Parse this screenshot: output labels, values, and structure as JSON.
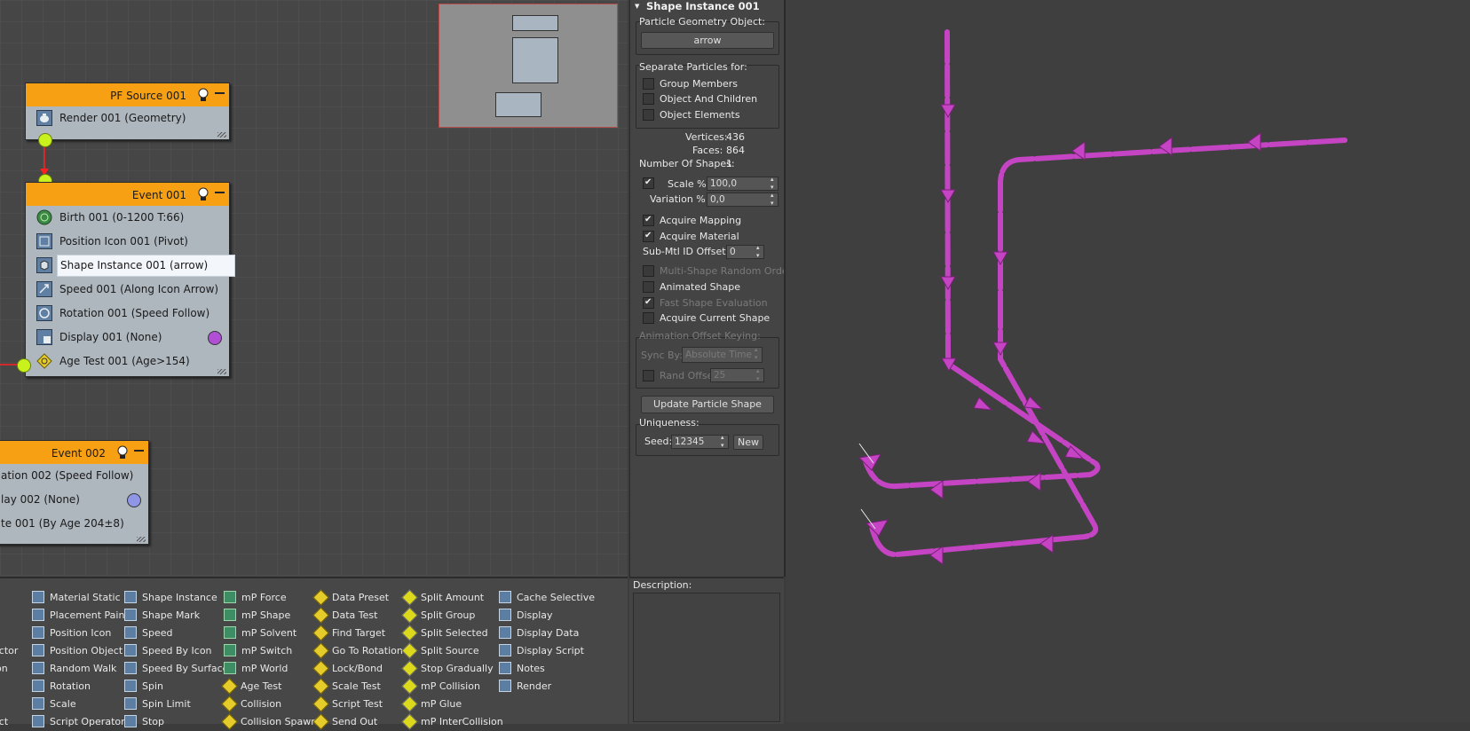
{
  "graph": {
    "nodes": {
      "pf_source": {
        "title": "PF Source 001",
        "rows": [
          "Render 001 (Geometry)"
        ]
      },
      "event001": {
        "title": "Event 001",
        "rows": [
          "Birth 001 (0-1200 T:66)",
          "Position Icon 001 (Pivot)",
          "Shape Instance 001 (arrow)",
          "Speed 001 (Along Icon Arrow)",
          "Rotation 001 (Speed Follow)",
          "Display 001 (None)",
          "Age Test 001 (Age>154)"
        ]
      },
      "event002": {
        "title": "Event 002",
        "rows": [
          "ation 002 (Speed Follow)",
          "lay 002 (None)",
          "te 001 (By Age 204±8)"
        ]
      }
    },
    "colors": {
      "header": "#f8a013",
      "wire": "#ff2020",
      "display001": "#b04fd6",
      "display002": "#8f96e6"
    }
  },
  "depot": {
    "col0": [
      "ector",
      "ion",
      "ect"
    ],
    "col1": [
      "Material Static",
      "Placement Paint",
      "Position Icon",
      "Position Object",
      "Random Walk",
      "Rotation",
      "Scale",
      "Script Operator"
    ],
    "col2": [
      "Shape Instance",
      "Shape Mark",
      "Speed",
      "Speed By Icon",
      "Speed By Surface",
      "Spin",
      "Spin Limit",
      "Stop"
    ],
    "col3": [
      "mP Force",
      "mP Shape",
      "mP Solvent",
      "mP Switch",
      "mP World",
      "Age Test",
      "Collision",
      "Collision Spawn"
    ],
    "col4": [
      "Data Preset",
      "Data Test",
      "Find Target",
      "Go To Rotation",
      "Lock/Bond",
      "Scale Test",
      "Script Test",
      "Send Out"
    ],
    "col5": [
      "Split Amount",
      "Split Group",
      "Split Selected",
      "Split Source",
      "Stop Gradually",
      "mP Collision",
      "mP Glue",
      "mP InterCollision"
    ],
    "col6": [
      "Cache Selective",
      "Display",
      "Display Data",
      "Display Script",
      "Notes",
      "Render"
    ]
  },
  "panel": {
    "title": "Shape Instance 001",
    "geom_label": "Particle Geometry Object:",
    "geom_button": "arrow",
    "separate_label": "Separate Particles for:",
    "separate": [
      "Group Members",
      "Object And Children",
      "Object Elements"
    ],
    "vertices_label": "Vertices:",
    "vertices": "436",
    "faces_label": "Faces:",
    "faces": "864",
    "shapes_label": "Number Of Shapes:",
    "shapes": "1",
    "scale_label": "Scale %",
    "scale": "100,0",
    "variation_label": "Variation %",
    "variation": "0,0",
    "acquire_mapping": "Acquire Mapping",
    "acquire_material": "Acquire Material",
    "submtl_label": "Sub-Mtl ID Offset:",
    "submtl": "0",
    "multishape": "Multi-Shape Random Order",
    "animated": "Animated Shape",
    "fast_eval": "Fast Shape Evaluation",
    "acquire_current": "Acquire Current Shape",
    "anim_offset_label": "Animation Offset Keying:",
    "sync_label": "Sync By:",
    "sync": "Absolute Time",
    "rand_offset": "Rand Offset",
    "rand_offset_val": "25",
    "update_button": "Update Particle Shape",
    "uniqueness_label": "Uniqueness:",
    "seed_label": "Seed:",
    "seed": "12345",
    "new_button": "New",
    "description_label": "Description:"
  }
}
